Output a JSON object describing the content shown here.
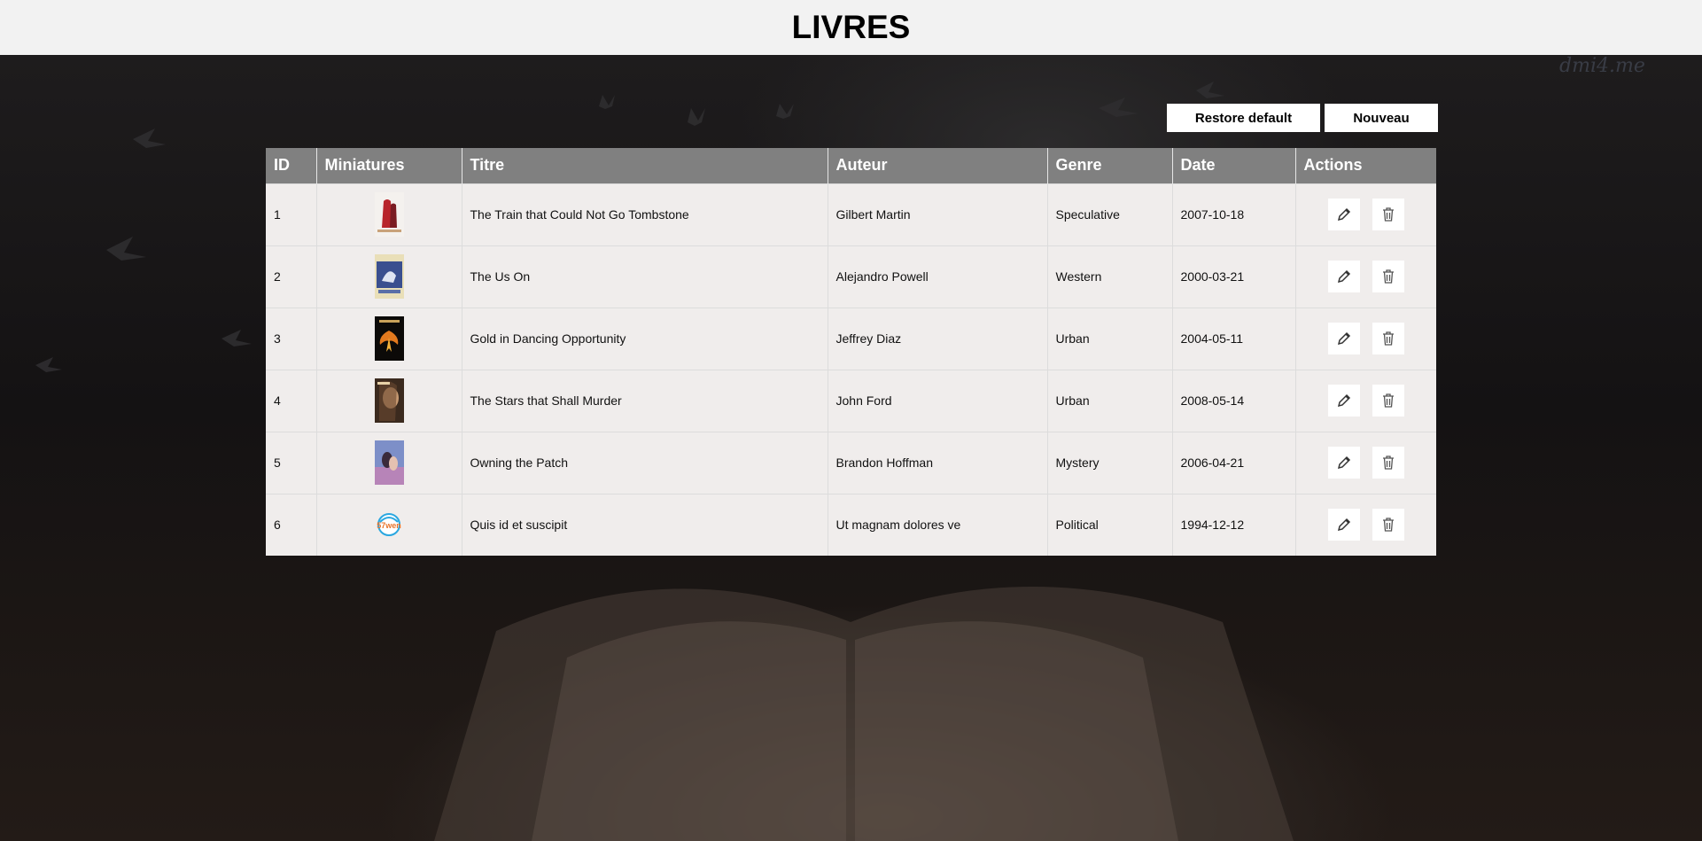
{
  "header": {
    "title": "LIVRES"
  },
  "watermark": "dmi4.me",
  "toolbar": {
    "restore_label": "Restore default",
    "new_label": "Nouveau"
  },
  "table": {
    "columns": [
      "ID",
      "Miniatures",
      "Titre",
      "Auteur",
      "Genre",
      "Date",
      "Actions"
    ],
    "rows": [
      {
        "id": "1",
        "title": "The Train that Could Not Go Tombstone",
        "author": "Gilbert Martin",
        "genre": "Speculative",
        "date": "2007-10-18",
        "thumb": "cover-red-couple"
      },
      {
        "id": "2",
        "title": "The Us On",
        "author": "Alejandro Powell",
        "genre": "Western",
        "date": "2000-03-21",
        "thumb": "cover-blue-horse"
      },
      {
        "id": "3",
        "title": "Gold in Dancing Opportunity",
        "author": "Jeffrey Diaz",
        "genre": "Urban",
        "date": "2004-05-11",
        "thumb": "cover-phoenix"
      },
      {
        "id": "4",
        "title": "The Stars that Shall Murder",
        "author": "John Ford",
        "genre": "Urban",
        "date": "2008-05-14",
        "thumb": "cover-portrait"
      },
      {
        "id": "5",
        "title": "Owning the Patch",
        "author": "Brandon Hoffman",
        "genre": "Mystery",
        "date": "2006-04-21",
        "thumb": "cover-couple-blue"
      },
      {
        "id": "6",
        "title": "Quis id et suscipit",
        "author": "Ut magnam dolores ve",
        "genre": "Political",
        "date": "1994-12-12",
        "thumb": "logo-57wen"
      }
    ],
    "row_actions": {
      "edit_icon": "pencil-icon",
      "delete_icon": "trash-icon"
    }
  },
  "thumb_logo_text": "57wen"
}
